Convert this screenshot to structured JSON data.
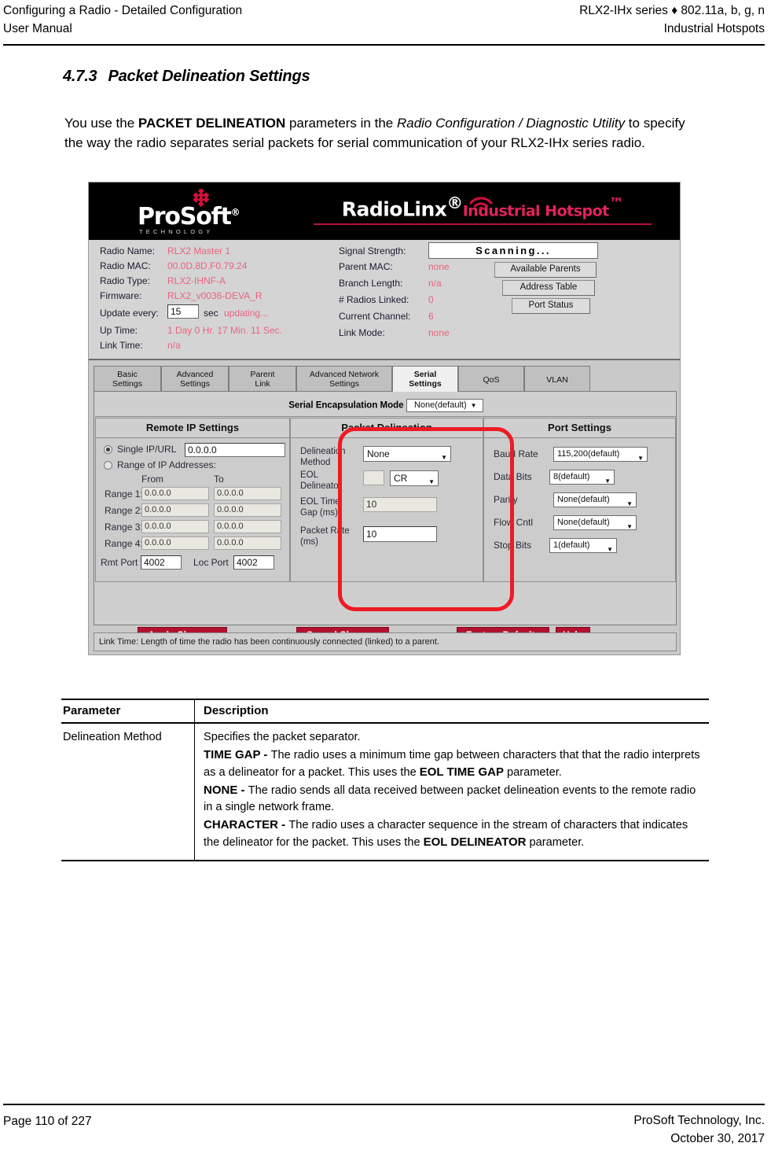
{
  "running_head": {
    "left_line1": "Configuring a Radio - Detailed Configuration",
    "left_line2": "User Manual",
    "right_line1": "RLX2-IHx series ♦ 802.11a, b, g, n",
    "right_line2": "Industrial Hotspots"
  },
  "section": {
    "number": "4.7.3",
    "title": "Packet Delineation Settings",
    "intro_1": "You use the ",
    "intro_emph": "PACKET DELINEATION",
    "intro_2": " parameters in the ",
    "intro_italic": "Radio Configuration / Diagnostic Utility",
    "intro_3": " to specify the way the radio separates serial packets for serial communication of your RLX2-IHx series radio."
  },
  "app": {
    "banner": {
      "logo_text": "ProSoft",
      "logo_reg": "®",
      "logo_tagline": "TECHNOLOGY",
      "brand_name": "RadioLinx",
      "brand_reg": "®",
      "brand_product": "Industrial Hotspot",
      "brand_tm": "™"
    },
    "status_left": [
      {
        "label": "Radio Name:",
        "value": "RLX2 Master 1"
      },
      {
        "label": "Radio MAC:",
        "value": "00.0D.8D.F0.79.24"
      },
      {
        "label": "Radio Type:",
        "value": "RLX2-IHNF-A"
      },
      {
        "label": "Firmware:",
        "value": "RLX2_v0036-DEVA_R"
      },
      {
        "label": "Update every:",
        "value": ""
      },
      {
        "label": "Up Time:",
        "value": "1 Day 0 Hr. 17 Min. 11 Sec."
      },
      {
        "label": "Link Time:",
        "value": "n/a"
      }
    ],
    "update_interval_value": "15",
    "update_unit": "sec",
    "update_status": "updating...",
    "status_right": [
      {
        "label": "Signal Strength:",
        "value": ""
      },
      {
        "label": "Parent MAC:",
        "value": "none"
      },
      {
        "label": "Branch Length:",
        "value": "n/a"
      },
      {
        "label": "# Radios Linked:",
        "value": "0"
      },
      {
        "label": "Current Channel:",
        "value": "6"
      },
      {
        "label": "Link Mode:",
        "value": "none"
      }
    ],
    "signal_strength_value": "Scanning...",
    "side_buttons": [
      {
        "label": "Available Parents"
      },
      {
        "label": "Address Table"
      },
      {
        "label": "Port Status"
      }
    ],
    "tabs": [
      {
        "line1": "Basic",
        "line2": "Settings",
        "active": false
      },
      {
        "line1": "Advanced",
        "line2": "Settings",
        "active": false
      },
      {
        "line1": "Parent",
        "line2": "Link",
        "active": false
      },
      {
        "line1": "Advanced Network",
        "line2": "Settings",
        "active": false
      },
      {
        "line1": "Serial",
        "line2": "Settings",
        "active": true
      },
      {
        "line1": "QoS",
        "line2": "",
        "active": false
      },
      {
        "line1": "VLAN",
        "line2": "",
        "active": false
      }
    ],
    "encapsulation": {
      "label": "Serial Encapsulation Mode",
      "value": "None(default)"
    },
    "columns": {
      "remote_ip": {
        "title": "Remote IP Settings",
        "single_label": "Single IP/URL",
        "single_value": "0.0.0.0",
        "range_label": "Range of IP Addresses:",
        "from_header": "From",
        "to_header": "To",
        "ranges": [
          {
            "label": "Range 1:",
            "from": "0.0.0.0",
            "to": "0.0.0.0"
          },
          {
            "label": "Range 2:",
            "from": "0.0.0.0",
            "to": "0.0.0.0"
          },
          {
            "label": "Range 3:",
            "from": "0.0.0.0",
            "to": "0.0.0.0"
          },
          {
            "label": "Range 4:",
            "from": "0.0.0.0",
            "to": "0.0.0.0"
          }
        ],
        "rmt_port_label": "Rmt Port",
        "rmt_port_value": "4002",
        "loc_port_label": "Loc Port",
        "loc_port_value": "4002"
      },
      "packet_delineation": {
        "title": "Packet Delineation",
        "method_label": "Delineation Method",
        "method_value": "None",
        "eol_delineator_label": "EOL Delineator",
        "eol_delineator_char": "",
        "eol_delineator_value": "CR",
        "eol_time_gap_label": "EOL Time Gap (ms)",
        "eol_time_gap_value": "10",
        "packet_rate_label": "Packet Rate (ms)",
        "packet_rate_value": "10"
      },
      "port_settings": {
        "title": "Port Settings",
        "fields": [
          {
            "label": "Baud Rate",
            "value": "115,200(default)"
          },
          {
            "label": "Data Bits",
            "value": "8(default)"
          },
          {
            "label": "Parity",
            "value": "None(default)"
          },
          {
            "label": "Flow Cntl",
            "value": "None(default)"
          },
          {
            "label": "Stop Bits",
            "value": "1(default)"
          }
        ]
      }
    },
    "buttons": [
      {
        "label": "Apply Changes"
      },
      {
        "label": "Cancel Changes"
      },
      {
        "label": "Factory Defaults"
      },
      {
        "label": "Help"
      }
    ],
    "statusbar": "Link Time: Length of time the radio has been continuously connected (linked) to a parent.",
    "annotation_color": "#ee1b24"
  },
  "table": {
    "headers": {
      "parameter": "Parameter",
      "description": "Description"
    },
    "rows": [
      {
        "parameter": "Delineation Method",
        "lead": "Specifies the packet separator.",
        "items": [
          {
            "term": "TIME GAP",
            "dash": " - ",
            "text_1": "The radio uses a minimum time gap between characters that that the radio interprets as a delineator for a packet. This uses the ",
            "emph": "EOL TIME GAP",
            "text_2": " parameter."
          },
          {
            "term": "NONE",
            "dash": " - ",
            "text_1": "The radio sends all data received between packet delineation events to the remote radio in a single network frame.",
            "emph": "",
            "text_2": ""
          },
          {
            "term": "CHARACTER",
            "dash": " - ",
            "text_1": "The radio uses a character sequence in the stream of characters that indicates the delineator for the packet. This uses the ",
            "emph": "EOL DELINEATOR",
            "text_2": " parameter."
          }
        ]
      }
    ]
  },
  "footer": {
    "page": "Page 110 of 227",
    "company": "ProSoft Technology, Inc.",
    "date": "October 30, 2017"
  }
}
